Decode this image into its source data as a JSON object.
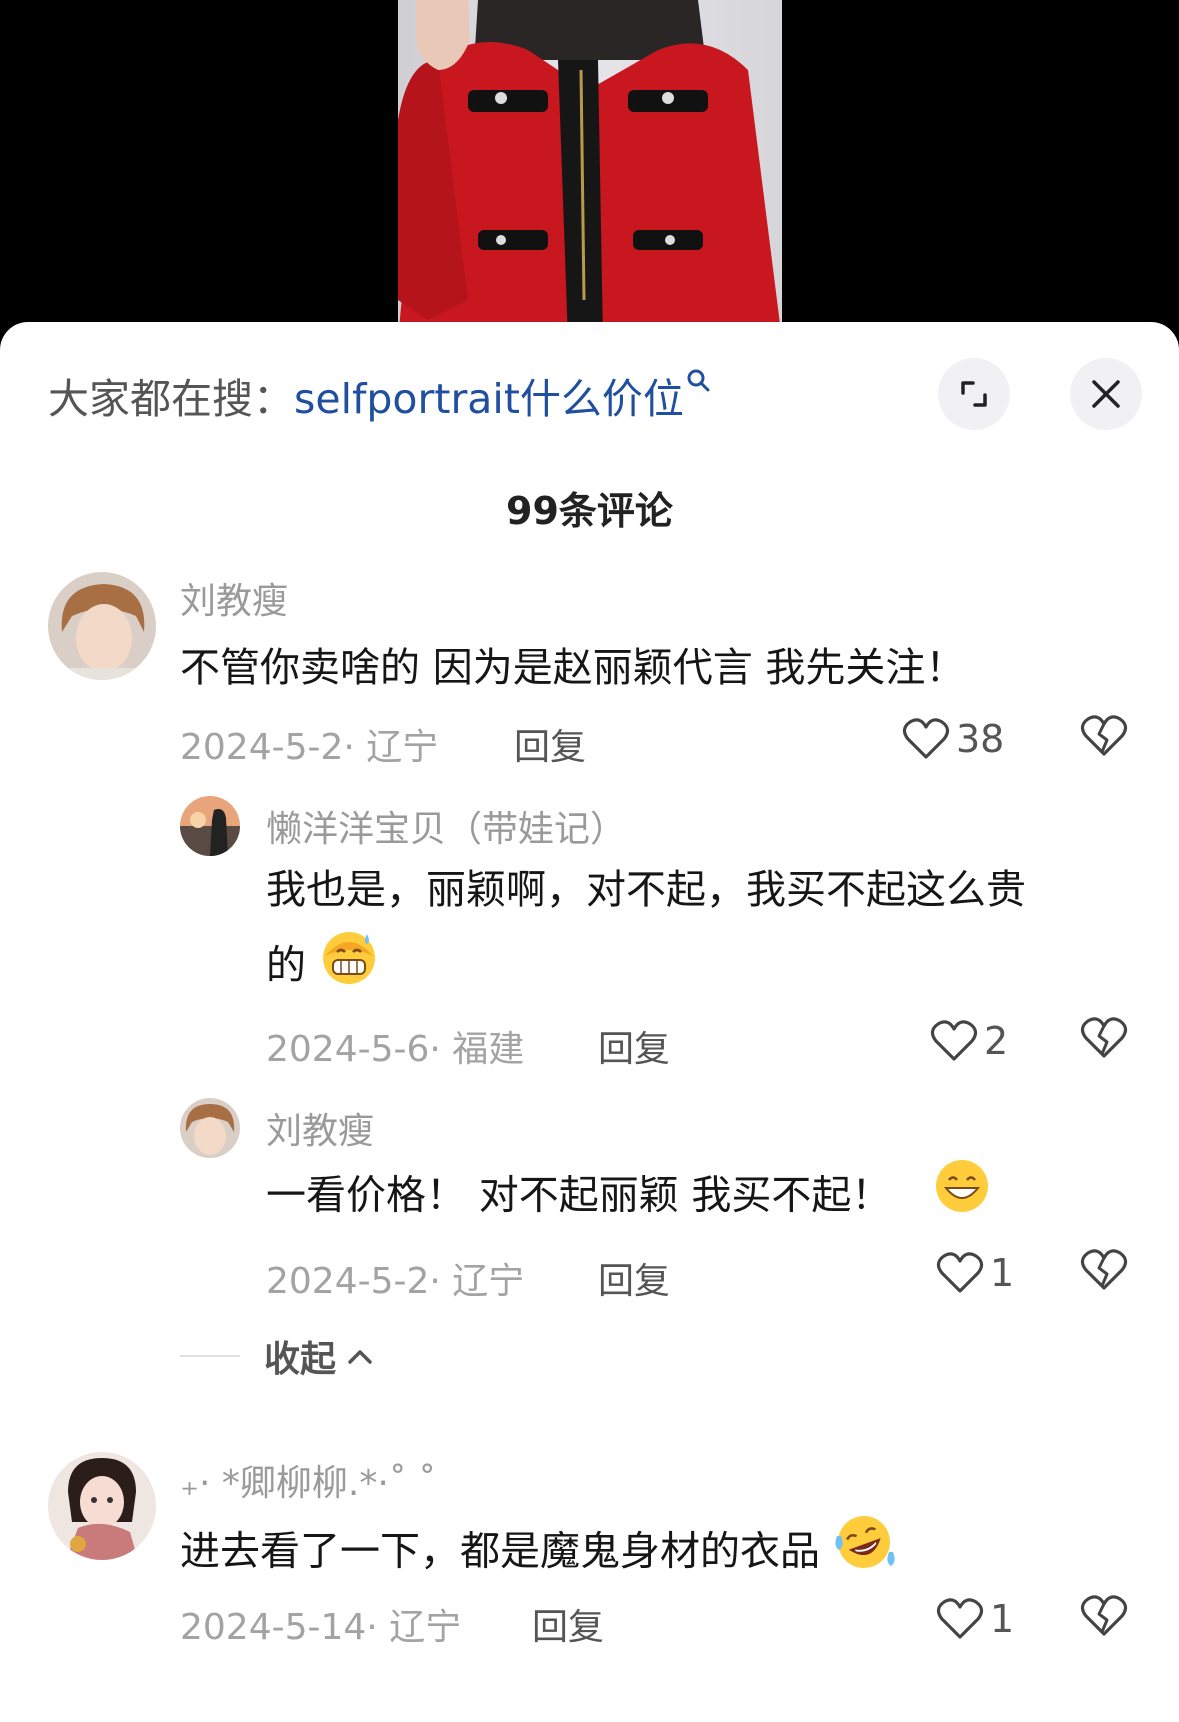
{
  "search": {
    "prefix": "大家都在搜：",
    "query": "selfportrait什么价位"
  },
  "comments_count_title": "99条评论",
  "comments": [
    {
      "user": "刘教瘦",
      "text": "不管你卖啥的 因为是赵丽颖代言 我先关注！",
      "meta": "2024-5-2· 辽宁",
      "reply_label": "回复",
      "likes": "38"
    },
    {
      "user": "懒洋洋宝贝（带娃记）",
      "text_line1": "我也是，丽颖啊，对不起，我买不起这么贵",
      "text_line2": "的",
      "meta": "2024-5-6· 福建",
      "reply_label": "回复",
      "likes": "2"
    },
    {
      "user": "刘教瘦",
      "text": "一看价格！ 对不起丽颖 我买不起！",
      "meta": "2024-5-2· 辽宁",
      "reply_label": "回复",
      "likes": "1"
    },
    {
      "user": "₊· *卿柳柳.*·˚ ˚",
      "text": "进去看了一下，都是魔鬼身材的衣品",
      "meta": "2024-5-14· 辽宁",
      "reply_label": "回复",
      "likes": "1"
    }
  ],
  "collapse_label": "收起",
  "icons": {
    "search": "search-icon",
    "expand": "expand-icon",
    "close": "close-icon",
    "like": "heart-icon",
    "dislike": "broken-heart-icon",
    "collapse": "chevron-up-icon"
  },
  "colors": {
    "link": "#1f4f9e",
    "jacket": "#c8171f",
    "muted_text": "#9a9a9a"
  }
}
